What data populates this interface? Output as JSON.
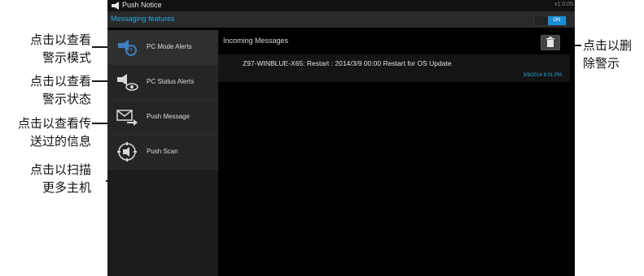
{
  "app": {
    "title": "Push Notice",
    "version": "v1.0.05",
    "feature_bar_title": "Messaging features",
    "toggle_label": "ON"
  },
  "sidebar": {
    "items": [
      {
        "label": "PC Mode Alerts",
        "icon": "pc-mode-alert-icon"
      },
      {
        "label": "PC Status Alerts",
        "icon": "pc-status-eye-icon"
      },
      {
        "label": "Push Message",
        "icon": "envelope-arrow-icon"
      },
      {
        "label": "Push Scan",
        "icon": "scan-target-icon"
      }
    ]
  },
  "main": {
    "section_title": "Incoming Messages",
    "delete_icon": "trash-icon",
    "messages": [
      {
        "text": "Z97-WINBLUE-X65: Restart : 2014/3/9 00:00 Restart for OS Update",
        "time": "3/9/2014  8:31 PM"
      }
    ]
  },
  "callouts": {
    "mode_alerts": [
      "点击以查看",
      "警示模式"
    ],
    "status_alerts": [
      "点击以查看",
      "警示状态"
    ],
    "push_message": [
      "点击以查看传",
      "送过的信息"
    ],
    "push_scan": [
      "点击以扫描",
      "更多主机"
    ],
    "delete": [
      "点击以删",
      "除警示"
    ]
  },
  "colors": {
    "accent": "#29a8e0",
    "toggle_on": "#1a8fd6",
    "background": "#000000"
  }
}
